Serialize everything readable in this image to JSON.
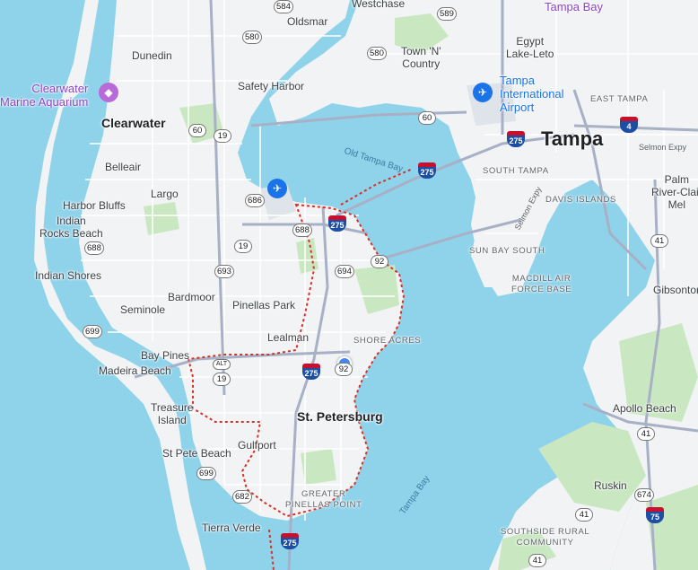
{
  "colors": {
    "water": "#8fd3eb",
    "land": "#f1f3f4",
    "park": "#c9e8c2",
    "road": "#ffffff",
    "highway": "#a8b0c6",
    "boundary": "#d93025",
    "location": "#4285f4"
  },
  "cities": {
    "tampa": "Tampa",
    "st_petersburg": "St. Petersburg",
    "clearwater": "Clearwater"
  },
  "places": {
    "westchase": "Westchase",
    "oldsmar": "Oldsmar",
    "tampa_bay_top": "Tampa Bay",
    "dunedin": "Dunedin",
    "egypt_lake": "Egypt\nLake-Leto",
    "town_n_country": "Town 'N'\nCountry",
    "safety_harbor": "Safety Harbor",
    "belleair": "Belleair",
    "largo": "Largo",
    "harbor_bluffs": "Harbor Bluffs",
    "indian_rocks": "Indian\nRocks Beach",
    "indian_shores": "Indian Shores",
    "bardmoor": "Bardmoor",
    "seminole": "Seminole",
    "pinellas_park": "Pinellas Park",
    "lealman": "Lealman",
    "bay_pines": "Bay Pines",
    "madeira_beach": "Madeira Beach",
    "treasure_island": "Treasure\nIsland",
    "gulfport": "Gulfport",
    "st_pete_beach": "St Pete Beach",
    "tierra_verde": "Tierra Verde",
    "palm_river": "Palm\nRiver-Clair\nMel",
    "gibsonton": "Gibsonton",
    "apollo_beach": "Apollo Beach",
    "ruskin": "Ruskin"
  },
  "caps_labels": {
    "east_tampa": "EAST TAMPA",
    "south_tampa": "SOUTH TAMPA",
    "davis_islands": "DAVIS ISLANDS",
    "sun_bay_south": "SUN BAY SOUTH",
    "macdill": "MACDILL AIR\nFORCE BASE",
    "shore_acres": "SHORE ACRES",
    "greater_pinellas": "GREATER\nPINELLAS POINT",
    "southside_rural": "SOUTHSIDE RURAL\nCOMMUNITY"
  },
  "water_labels": {
    "old_tampa_bay": "Old Tampa Bay",
    "tampa_bay": "Tampa Bay",
    "selmon_expy": "Selmon Expy"
  },
  "pois": {
    "clearwater_aquarium": "Clearwater\nMarine Aquarium",
    "tampa_airport": "Tampa\nInternational\nAirport"
  },
  "shields": {
    "s584": "584",
    "s580a": "580",
    "s589": "589",
    "s580b": "580",
    "s60a": "60",
    "s19a": "19",
    "s60b": "60",
    "s686": "686",
    "s688a": "688",
    "s688b": "688",
    "s19b": "19",
    "s693": "693",
    "s694": "694",
    "s92a": "92",
    "s699a": "699",
    "salt": "ALT\n19",
    "s19c": "19",
    "s92b": "92",
    "s699b": "699",
    "s682": "682",
    "s41a": "41",
    "s41b": "41",
    "s674": "674",
    "s41c": "41",
    "s41d": "41"
  },
  "interstates": {
    "i275a": "275",
    "i275b": "275",
    "i275c": "275",
    "i275d": "275",
    "i275e": "275",
    "i4": "4",
    "i75": "75"
  },
  "icons": {
    "airport": "airplane-icon",
    "aquarium": "aquarium-icon",
    "location": "current-location-dot"
  }
}
